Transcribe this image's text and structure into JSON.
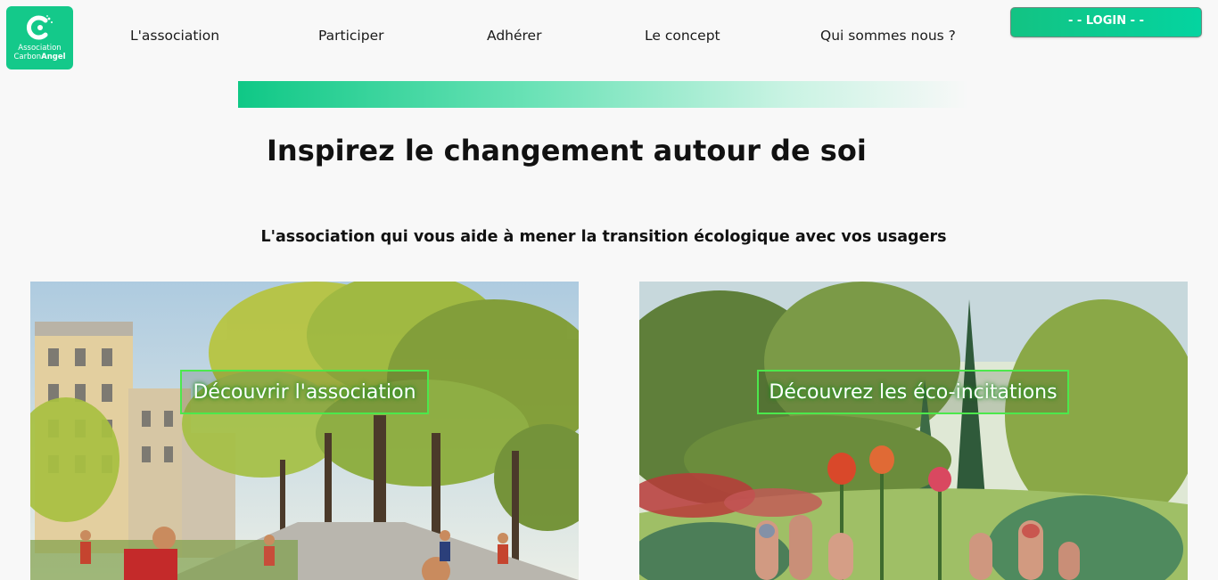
{
  "logo": {
    "line1": "Association",
    "line2_a": "Carbon",
    "line2_b": "Angel"
  },
  "nav": {
    "items": [
      {
        "label": "L'association"
      },
      {
        "label": "Participer"
      },
      {
        "label": "Adhérer"
      },
      {
        "label": "Le concept"
      },
      {
        "label": "Qui sommes nous ?"
      }
    ],
    "login_label": "- - LOGIN - -"
  },
  "hero": {
    "title": "Inspirez le changement autour de soi",
    "subtitle": "L'association qui vous aide à mener la transition écologique avec vos usagers"
  },
  "cards": [
    {
      "button_label": "Découvrir l'association"
    },
    {
      "button_label": "Découvrez les éco-incitations"
    }
  ],
  "colors": {
    "brand": "#14c98a",
    "button_border": "#4ce84c"
  }
}
